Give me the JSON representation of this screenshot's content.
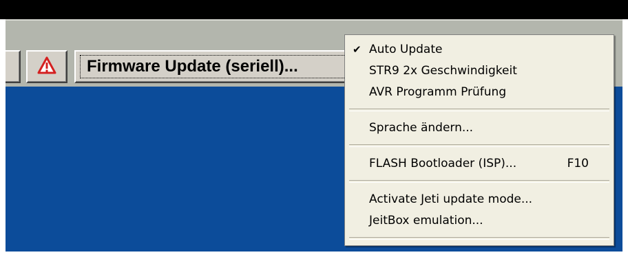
{
  "toolbar": {
    "firmware_button_label": "Firmware Update (seriell)..."
  },
  "icons": {
    "warning": "warning-triangle-icon",
    "check": "checkmark-icon"
  },
  "colors": {
    "workspace_bg": "#0c4c9a",
    "toolbar_bg": "#b3b6ad",
    "menu_bg": "#f1efe2",
    "warning_red": "#d42020"
  },
  "menu": {
    "auto_update": {
      "label": "Auto Update",
      "checked": true,
      "check_glyph": "✔"
    },
    "str9_speed": {
      "label": "STR9 2x Geschwindigkeit"
    },
    "avr_check": {
      "label": "AVR Programm Prüfung"
    },
    "change_language": {
      "label": "Sprache ändern..."
    },
    "flash_bootloader": {
      "label": "FLASH Bootloader (ISP)...",
      "shortcut": "F10"
    },
    "jeti_update": {
      "label": "Activate Jeti update mode..."
    },
    "jeitbox_emulation": {
      "label": "JeitBox emulation..."
    }
  }
}
